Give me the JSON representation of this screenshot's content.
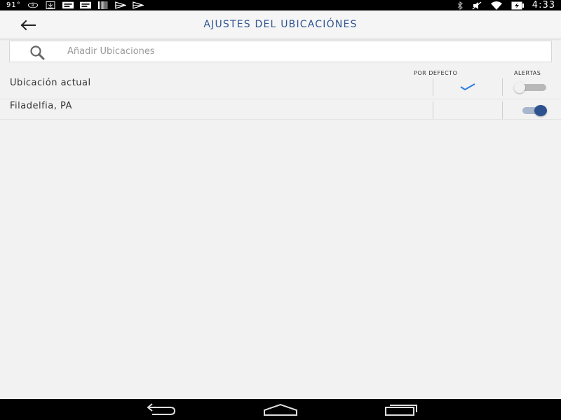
{
  "status_bar": {
    "temperature": "91°",
    "time": "4:33",
    "left_icons": [
      "registered-icon",
      "download-icon",
      "message-icon",
      "message-icon",
      "barcode-icon",
      "play-store-icon",
      "play-store-icon"
    ],
    "right_icons": [
      "bluetooth-icon",
      "mute-icon",
      "wifi-icon",
      "battery-charging-icon"
    ]
  },
  "app_bar": {
    "title": "AJUSTES DEL UBICACIÓNES",
    "back_icon": "arrow-left-icon"
  },
  "search": {
    "placeholder": "Añadir Ubicaciones",
    "value": "",
    "icon": "search-icon"
  },
  "columns": {
    "default_label": "POR DEFECTO",
    "alerts_label": "ALERTAS"
  },
  "locations": [
    {
      "name": "Ubicación actual",
      "is_default": true,
      "alerts_on": false
    },
    {
      "name": "Filadelfia, PA",
      "is_default": false,
      "alerts_on": true
    }
  ],
  "colors": {
    "accent": "#2f5491",
    "check": "#2b7de0",
    "toggle_on": "#2e5290",
    "background": "#f2f2f2"
  },
  "nav_bar": {
    "icons": [
      "back-icon",
      "home-icon",
      "recents-icon"
    ]
  }
}
